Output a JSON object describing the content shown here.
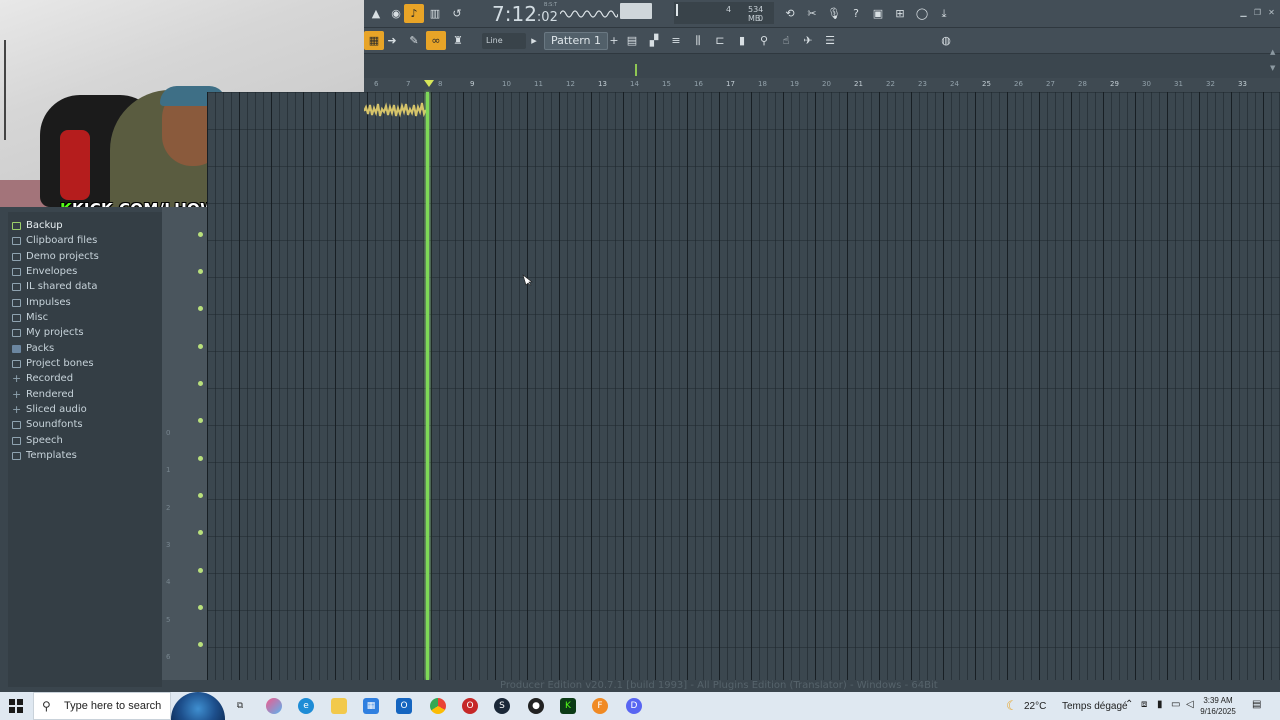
{
  "overlay": {
    "kick_prefix": "K",
    "kick_rest": "KICK.COM/LHOWARII"
  },
  "transport": {
    "time_main": "7:12",
    "time_sub": ":02",
    "time_label": "B:S:T",
    "memory": "534 MB",
    "cpu_top": "4",
    "cpu_bottom": "0"
  },
  "toolbar": {
    "snap_label": "Line",
    "pattern_label": "Pattern 1"
  },
  "browser": {
    "items": [
      {
        "label": "Backup",
        "icon": "folder-icon",
        "selected": true
      },
      {
        "label": "Clipboard files",
        "icon": "folder-icon"
      },
      {
        "label": "Demo projects",
        "icon": "folder-icon"
      },
      {
        "label": "Envelopes",
        "icon": "folder-icon"
      },
      {
        "label": "IL shared data",
        "icon": "folder-icon"
      },
      {
        "label": "Impulses",
        "icon": "folder-icon"
      },
      {
        "label": "Misc",
        "icon": "folder-icon"
      },
      {
        "label": "My projects",
        "icon": "folder-icon"
      },
      {
        "label": "Packs",
        "icon": "packs-icon"
      },
      {
        "label": "Project bones",
        "icon": "folder-icon"
      },
      {
        "label": "Recorded",
        "icon": "plus-icon"
      },
      {
        "label": "Rendered",
        "icon": "plus-icon"
      },
      {
        "label": "Sliced audio",
        "icon": "plus-icon"
      },
      {
        "label": "Soundfonts",
        "icon": "folder-icon"
      },
      {
        "label": "Speech",
        "icon": "folder-icon"
      },
      {
        "label": "Templates",
        "icon": "folder-icon"
      }
    ]
  },
  "ruler": {
    "ticks": [
      "6",
      "7",
      "8",
      "9",
      "10",
      "11",
      "12",
      "13",
      "14",
      "15",
      "16",
      "17",
      "18",
      "19",
      "20",
      "21",
      "22",
      "23",
      "24",
      "25",
      "26",
      "27",
      "28",
      "29",
      "30",
      "31",
      "32",
      "33"
    ]
  },
  "keys": {
    "octaves": [
      "0",
      "1",
      "2",
      "3",
      "4",
      "5",
      "6"
    ]
  },
  "status_line": "Producer Edition v20.7.1 [build 1993] - All Plugins Edition (Translator) - Windows - 64Bit",
  "taskbar": {
    "search_placeholder": "Type here to search",
    "weather_temp": "22°C",
    "weather_desc": "Temps dégagé",
    "time": "3:39 AM",
    "date": "9/16/2025"
  },
  "colors": {
    "accent_orange": "#e8a427",
    "playhead_green": "#7ed957",
    "kick_green": "#53fc18"
  }
}
